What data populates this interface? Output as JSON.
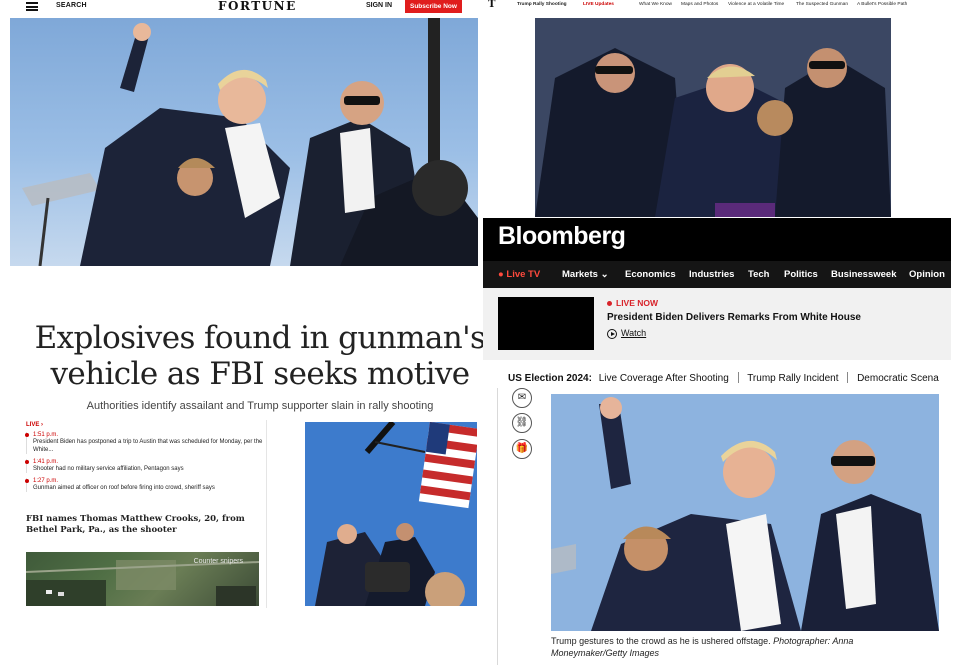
{
  "fortune": {
    "search_label": "SEARCH",
    "logo": "FORTUNE",
    "signin_label": "SIGN IN",
    "subscribe_label": "Subscribe Now"
  },
  "nyt": {
    "logo": "T",
    "nav": [
      {
        "label": "Trump Rally Shooting"
      },
      {
        "label": "LIVE Updates"
      },
      {
        "label": "What We Know"
      },
      {
        "label": "Maps and Photos"
      },
      {
        "label": "Violence at a Volatile Time"
      },
      {
        "label": "The Suspected Gunman"
      },
      {
        "label": "A Bullet's Possible Path"
      }
    ]
  },
  "wapo": {
    "headline_line1": "Explosives found in gunman's",
    "headline_line2": "vehicle as FBI seeks motive",
    "subhead": "Authorities identify assailant and Trump supporter slain in rally shooting",
    "live_label": "LIVE",
    "live_items": [
      {
        "time": "1:51 p.m.",
        "text": "President Biden has postponed a trip to Austin that was scheduled for Monday, per the White..."
      },
      {
        "time": "1:41 p.m.",
        "text": "Shooter had no military service affiliation, Pentagon says"
      },
      {
        "time": "1:27 p.m.",
        "text": "Gunman aimed at officer on roof before firing into crowd, sheriff says"
      }
    ],
    "story_headline": "FBI names Thomas Matthew Crooks, 20, from Bethel Park, Pa., as the shooter",
    "map_label": "Counter snipers"
  },
  "bloomberg": {
    "logo": "Bloomberg",
    "nav": {
      "live_tv": "Live TV",
      "markets": "Markets",
      "economics": "Economics",
      "industries": "Industries",
      "tech": "Tech",
      "politics": "Politics",
      "businessweek": "Businessweek",
      "opinion": "Opinion"
    },
    "live_now_label": "LIVE NOW",
    "live_title": "President Biden Delivers Remarks From White House",
    "watch_label": "Watch",
    "election_label": "US Election 2024:",
    "election_links": [
      "Live Coverage After Shooting",
      "Trump Rally Incident",
      "Democratic Scena"
    ],
    "caption_main": "Trump gestures to the crowd as he is ushered offstage.",
    "caption_credit": "Photographer: Anna Moneymaker/Getty Images"
  },
  "colors": {
    "fortune_red": "#e01d1d",
    "bloomberg_black": "#000000",
    "live_red": "#d8232a"
  },
  "icons": [
    "menu-icon",
    "email-icon",
    "link-icon",
    "gift-icon",
    "play-icon",
    "chevron-down-icon",
    "live-dot-icon"
  ]
}
